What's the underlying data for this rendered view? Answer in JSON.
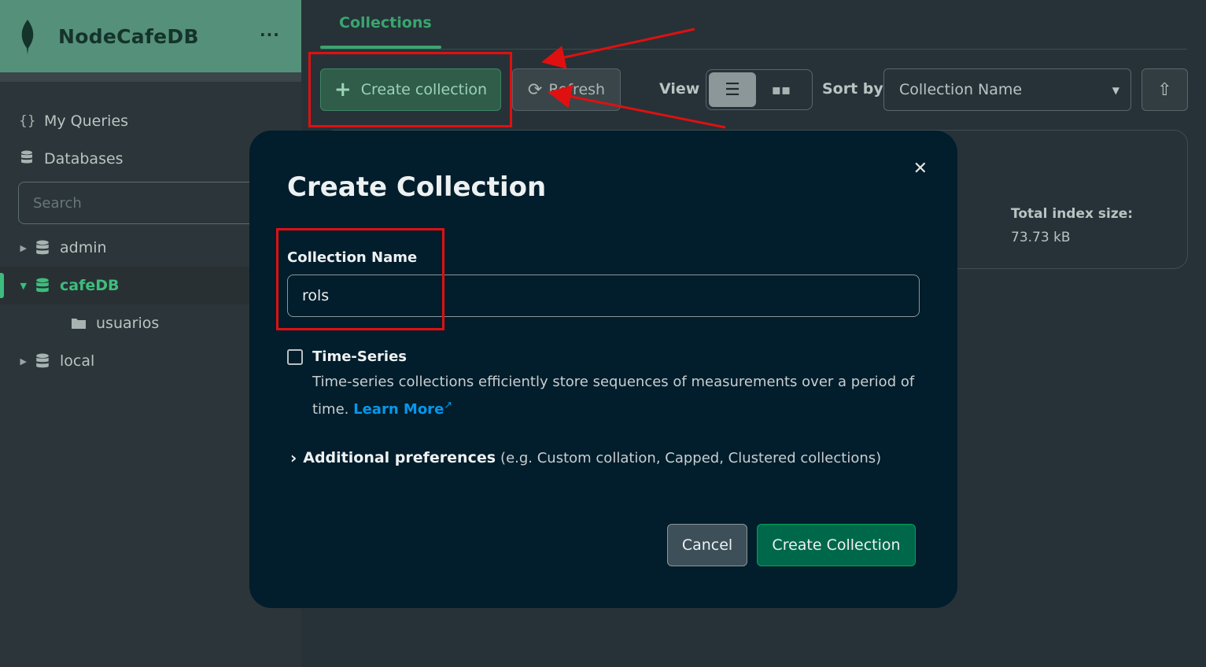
{
  "sidebar": {
    "app_title": "NodeCafeDB",
    "menu_icon": "ellipsis-icon",
    "nav": [
      {
        "label": "My Queries",
        "icon": "braces-icon"
      },
      {
        "label": "Databases",
        "icon": "database-icon"
      }
    ],
    "search_placeholder": "Search",
    "databases": [
      {
        "name": "admin",
        "expanded": false
      },
      {
        "name": "cafeDB",
        "expanded": true,
        "collections": [
          "usuarios"
        ]
      },
      {
        "name": "local",
        "expanded": false
      }
    ]
  },
  "main": {
    "tab_label": "Collections",
    "create_button": "Create collection",
    "refresh_button": "Refresh",
    "view_label": "View",
    "sort_label": "Sort by",
    "sort_value": "Collection Name",
    "card": {
      "index_size_label": "Total index size:",
      "index_size_value": "73.73 kB"
    }
  },
  "modal": {
    "title": "Create Collection",
    "name_label": "Collection Name",
    "name_value": "rols",
    "timeseries_label": "Time-Series",
    "timeseries_checked": false,
    "timeseries_desc": "Time-series collections efficiently store sequences of measurements over a period of time.",
    "learn_more": "Learn More",
    "additional_title": "Additional preferences",
    "additional_note": "(e.g. Custom collation, Capped, Clustered collections)",
    "cancel_button": "Cancel",
    "submit_button": "Create Collection"
  },
  "colors": {
    "accent_green": "#3aa56f",
    "annotation_red": "#e01010",
    "link_blue": "#0498ec"
  }
}
